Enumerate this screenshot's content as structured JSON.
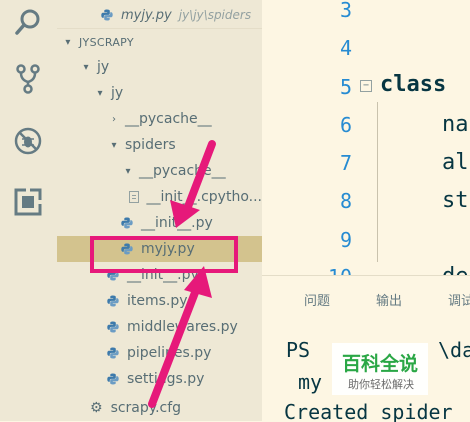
{
  "open_editor": {
    "file": "myjy.py",
    "path": "jy\\jy\\spiders"
  },
  "explorer": {
    "section_title": "JYSCRAPY",
    "tree": [
      {
        "label": "jy",
        "chevron": "▾"
      },
      {
        "label": "jy",
        "chevron": "▾"
      },
      {
        "label": "__pycache__",
        "chevron": "›"
      },
      {
        "label": "spiders",
        "chevron": "▾"
      },
      {
        "label": "__pycache__",
        "chevron": "▾"
      },
      {
        "label": "__init__.cpytho..."
      },
      {
        "label": "__init__.py"
      },
      {
        "label": "myjy.py",
        "selected": true
      },
      {
        "label": "__init__.py"
      },
      {
        "label": "items.py"
      },
      {
        "label": "middlewares.py"
      },
      {
        "label": "pipelines.py"
      },
      {
        "label": "settings.py"
      },
      {
        "label": "scrapy.cfg"
      }
    ]
  },
  "activity_bar": {
    "icons": [
      "search-icon",
      "source-control-icon",
      "debug-icon",
      "extensions-icon"
    ]
  },
  "editor": {
    "line_numbers": [
      "3",
      "4",
      "5",
      "6",
      "7",
      "8",
      "9",
      "10"
    ],
    "code": {
      "line5_keyword": "class",
      "line6": "na",
      "line7": "al",
      "line8": "st",
      "line10": "de"
    }
  },
  "panel": {
    "tabs": [
      "问题",
      "输出",
      "调试"
    ],
    "terminal": {
      "line1_prompt": "PS",
      "line1_tail": "\\da",
      "line2": "my",
      "line3": "Created spider"
    }
  },
  "watermark": {
    "title": "百科全说",
    "subtitle": "助你轻松解决"
  },
  "colors": {
    "background": "#fdf6e3",
    "sidebar": "#eee8d5",
    "selection": "#d3c38e",
    "line_numbers": "#268bd2",
    "annotation": "#e6197a",
    "watermark_green": "#2aa745"
  }
}
